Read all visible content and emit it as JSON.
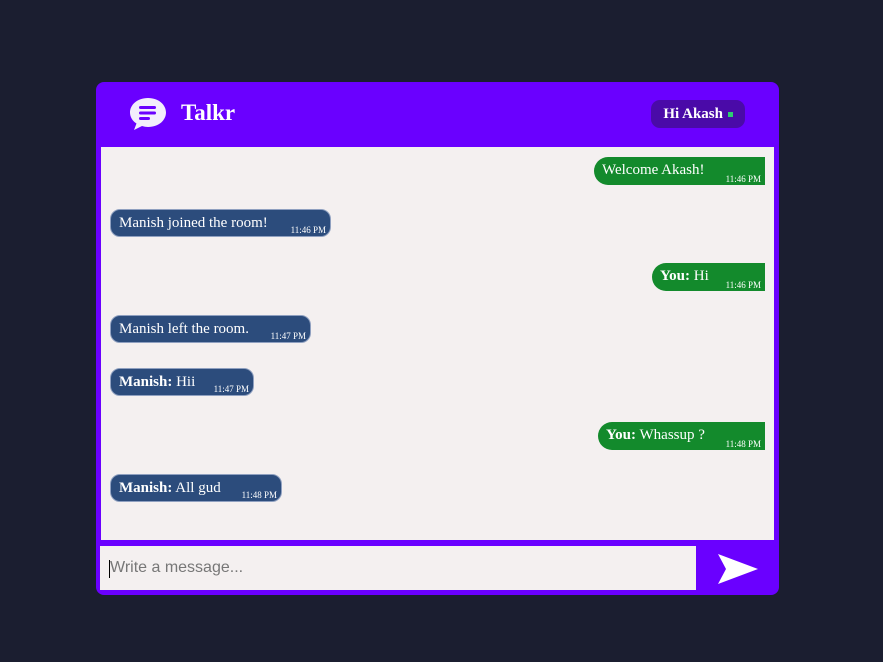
{
  "header": {
    "app_name": "Talkr",
    "user_greeting": "Hi Akash"
  },
  "messages": [
    {
      "type": "out",
      "sender": "",
      "text": "Welcome Akash!",
      "time": "11:46 PM"
    },
    {
      "type": "in",
      "sender": "",
      "text": "Manish joined the room!",
      "time": "11:46 PM"
    },
    {
      "type": "out",
      "sender": "You:",
      "text": "Hi",
      "time": "11:46 PM"
    },
    {
      "type": "in",
      "sender": "",
      "text": "Manish left the room.",
      "time": "11:47 PM"
    },
    {
      "type": "in",
      "sender": "Manish:",
      "text": "Hii",
      "time": "11:47 PM"
    },
    {
      "type": "out",
      "sender": "You:",
      "text": "Whassup ?",
      "time": "11:48 PM"
    },
    {
      "type": "in",
      "sender": "Manish:",
      "text": "All gud",
      "time": "11:48 PM"
    }
  ],
  "composer": {
    "placeholder": "Write a message..."
  },
  "colors": {
    "accent": "#6a00ff",
    "incoming": "#2c4c7c",
    "outgoing": "#138a2c"
  },
  "icons": {
    "logo": "chat-bubble-icon",
    "send": "send-icon"
  }
}
